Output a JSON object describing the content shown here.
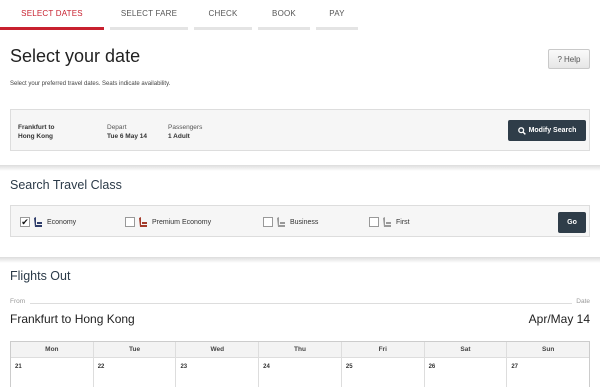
{
  "steps": [
    {
      "label": "SELECT DATES",
      "active": true
    },
    {
      "label": "SELECT FARE",
      "active": false
    },
    {
      "label": "CHECK",
      "active": false
    },
    {
      "label": "BOOK",
      "active": false
    },
    {
      "label": "PAY",
      "active": false
    }
  ],
  "header": {
    "title": "Select your date",
    "help_label": "Help",
    "subtitle": "Select your preferred travel dates. Seats indicate availability."
  },
  "trip": {
    "origin": "Frankfurt to",
    "destination": "Hong Kong",
    "depart_label": "Depart",
    "depart_value": "Tue 6 May 14",
    "passengers_label": "Passengers",
    "passengers_value": "1 Adult",
    "modify_label": "Modify Search"
  },
  "travel_class": {
    "title": "Search Travel Class",
    "options": [
      {
        "label": "Economy",
        "checked": true,
        "color": "#2f3d6b"
      },
      {
        "label": "Premium Economy",
        "checked": false,
        "color": "#a33a2a"
      },
      {
        "label": "Business",
        "checked": false,
        "color": "#999999"
      },
      {
        "label": "First",
        "checked": false,
        "color": "#999999"
      }
    ],
    "go_label": "Go"
  },
  "flights": {
    "title": "Flights Out",
    "from_label": "From",
    "date_label": "Date",
    "route": "Frankfurt to Hong Kong",
    "month": "Apr/May 14",
    "weekdays": [
      "Mon",
      "Tue",
      "Wed",
      "Thu",
      "Fri",
      "Sat",
      "Sun"
    ],
    "days": [
      "21",
      "22",
      "23",
      "24",
      "25",
      "26",
      "27"
    ]
  },
  "colors": {
    "accent": "#c8202f",
    "button_dark": "#2f3d49"
  }
}
